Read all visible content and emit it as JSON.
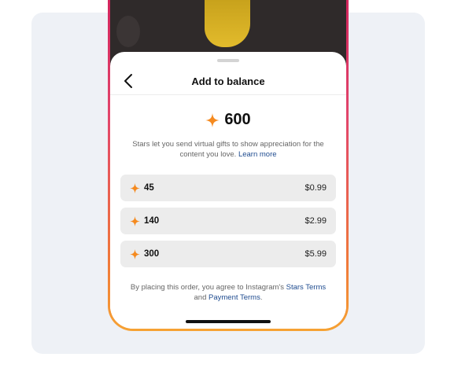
{
  "sheet": {
    "title": "Add to balance",
    "back_icon": "chevron-left-icon"
  },
  "balance": {
    "icon": "star-icon",
    "value": "600"
  },
  "description": {
    "text": "Stars let you send virtual gifts to show appreciation for the content you love.",
    "link": "Learn more"
  },
  "options": [
    {
      "amount": "45",
      "price": "$0.99"
    },
    {
      "amount": "140",
      "price": "$2.99"
    },
    {
      "amount": "300",
      "price": "$5.99"
    }
  ],
  "footer": {
    "prefix": "By placing this order, you agree to Instagram's",
    "stars_terms": "Stars Terms",
    "and": "and",
    "payment_terms": "Payment Terms",
    "suffix": "."
  },
  "colors": {
    "star": "#f58a1f",
    "link": "#1e4b8f",
    "option_bg": "#ececec",
    "frame_top": "#d4265e",
    "frame_bottom": "#f6a233"
  }
}
